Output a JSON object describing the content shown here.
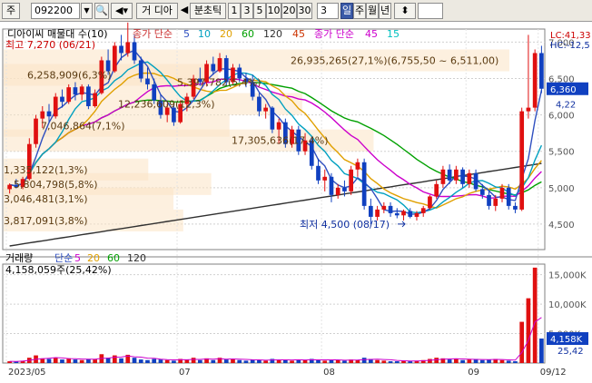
{
  "toolbar": {
    "market": "주",
    "code": "092200",
    "name_btn": "디아",
    "name_prefix": "거",
    "split_btn": "분초틱",
    "periods": [
      "1",
      "3",
      "5",
      "10",
      "20",
      "30"
    ],
    "count": "3",
    "day_btn": "일",
    "week_btn": "주",
    "month_btn": "월",
    "year_btn": "년"
  },
  "chart_data": [
    {
      "type": "candlestick",
      "title": "디아이씨 매물대 수(10)",
      "legend": [
        {
          "label": "종가 단순",
          "color": "#cc3333"
        },
        {
          "label": "5",
          "color": "#3050c0"
        },
        {
          "label": "10",
          "color": "#00a0c0"
        },
        {
          "label": "20",
          "color": "#e0a000"
        },
        {
          "label": "60",
          "color": "#00a000"
        },
        {
          "label": "120",
          "color": "#303030"
        },
        {
          "label": "45",
          "color": "#cc3300"
        },
        {
          "label": "종가 단순",
          "color": "#cc00cc"
        },
        {
          "label": "45",
          "color": "#cc00cc"
        },
        {
          "label": "15",
          "color": "#00c0c0"
        }
      ],
      "y_ticks": [
        4500,
        5000,
        5500,
        6000,
        6500,
        7000
      ],
      "ylim": [
        4150,
        7180
      ],
      "x_labels": [
        "2023/05",
        "07",
        "08",
        "09",
        "09/12"
      ],
      "x_label_index": [
        0,
        26,
        48,
        70,
        81
      ],
      "high_label": "최고 7,270 (06/21)",
      "low_label": "최저 4,500 (08/17)",
      "lc_label": "LC:41,33",
      "hc_label": "HC:-12,5",
      "pct_up_label": "4,22",
      "current_price": 6360,
      "current_price_label": "6,360",
      "volume_profile": [
        {
          "lo": 6400,
          "hi": 6700,
          "label": "6,258,909(6,3%)",
          "pct": 6.3
        },
        {
          "lo": 6600,
          "hi": 6900,
          "label": "26,935,265(27,1%)(6,755,50 ~ 6,511,00)",
          "pct": 27.1
        },
        {
          "lo": 6300,
          "hi": 6600,
          "label": "5,397,782(5,4%)",
          "pct": 5.4
        },
        {
          "lo": 6000,
          "hi": 6300,
          "label": "12,236,609(12,3%)",
          "pct": 12.3
        },
        {
          "lo": 5700,
          "hi": 6000,
          "label": "7,046,864(7,1%)",
          "pct": 7.1
        },
        {
          "lo": 5500,
          "hi": 5800,
          "label": "17,305,636(17,4%)",
          "pct": 17.4
        },
        {
          "lo": 5100,
          "hi": 5400,
          "label": "1,335,122(1,3%)",
          "pct": 1.3
        },
        {
          "lo": 4900,
          "hi": 5200,
          "label": "5,804,798(5,8%)",
          "pct": 5.8
        },
        {
          "lo": 4700,
          "hi": 5000,
          "label": "3,046,481(3,1%)",
          "pct": 3.1
        },
        {
          "lo": 4400,
          "hi": 4700,
          "label": "3,817,091(3,8%)",
          "pct": 3.8
        }
      ],
      "candles": [
        {
          "o": 4980,
          "h": 5060,
          "l": 4920,
          "c": 5040
        },
        {
          "o": 5040,
          "h": 5120,
          "l": 4990,
          "c": 5010
        },
        {
          "o": 5010,
          "h": 5150,
          "l": 4980,
          "c": 5120
        },
        {
          "o": 5120,
          "h": 5680,
          "l": 5100,
          "c": 5600
        },
        {
          "o": 5600,
          "h": 6000,
          "l": 5550,
          "c": 5950
        },
        {
          "o": 5950,
          "h": 6120,
          "l": 5820,
          "c": 6050
        },
        {
          "o": 6050,
          "h": 6150,
          "l": 5900,
          "c": 5980
        },
        {
          "o": 5980,
          "h": 6300,
          "l": 5950,
          "c": 6250
        },
        {
          "o": 6250,
          "h": 6350,
          "l": 6100,
          "c": 6180
        },
        {
          "o": 6180,
          "h": 6420,
          "l": 6150,
          "c": 6380
        },
        {
          "o": 6380,
          "h": 6450,
          "l": 6200,
          "c": 6280
        },
        {
          "o": 6280,
          "h": 6420,
          "l": 6200,
          "c": 6390
        },
        {
          "o": 6390,
          "h": 6420,
          "l": 6080,
          "c": 6120
        },
        {
          "o": 6120,
          "h": 6350,
          "l": 6100,
          "c": 6300
        },
        {
          "o": 6300,
          "h": 6800,
          "l": 6280,
          "c": 6750
        },
        {
          "o": 6750,
          "h": 6900,
          "l": 6550,
          "c": 6600
        },
        {
          "o": 6600,
          "h": 7000,
          "l": 6580,
          "c": 6950
        },
        {
          "o": 6950,
          "h": 7100,
          "l": 6750,
          "c": 6850
        },
        {
          "o": 6850,
          "h": 7270,
          "l": 6800,
          "c": 7000
        },
        {
          "o": 7000,
          "h": 7100,
          "l": 6700,
          "c": 6750
        },
        {
          "o": 6750,
          "h": 6800,
          "l": 6450,
          "c": 6500
        },
        {
          "o": 6500,
          "h": 6650,
          "l": 6350,
          "c": 6420
        },
        {
          "o": 6420,
          "h": 6500,
          "l": 6150,
          "c": 6200
        },
        {
          "o": 6200,
          "h": 6280,
          "l": 5950,
          "c": 6000
        },
        {
          "o": 6000,
          "h": 6150,
          "l": 5900,
          "c": 6100
        },
        {
          "o": 6100,
          "h": 6150,
          "l": 5850,
          "c": 5900
        },
        {
          "o": 5900,
          "h": 6200,
          "l": 5880,
          "c": 6150
        },
        {
          "o": 6150,
          "h": 6300,
          "l": 6050,
          "c": 6250
        },
        {
          "o": 6250,
          "h": 6550,
          "l": 6220,
          "c": 6500
        },
        {
          "o": 6500,
          "h": 6650,
          "l": 6400,
          "c": 6450
        },
        {
          "o": 6450,
          "h": 6750,
          "l": 6400,
          "c": 6700
        },
        {
          "o": 6700,
          "h": 6800,
          "l": 6550,
          "c": 6600
        },
        {
          "o": 6600,
          "h": 6850,
          "l": 6580,
          "c": 6780
        },
        {
          "o": 6780,
          "h": 6820,
          "l": 6400,
          "c": 6450
        },
        {
          "o": 6450,
          "h": 6700,
          "l": 6420,
          "c": 6650
        },
        {
          "o": 6650,
          "h": 6700,
          "l": 6450,
          "c": 6500
        },
        {
          "o": 6500,
          "h": 6580,
          "l": 6380,
          "c": 6450
        },
        {
          "o": 6450,
          "h": 6550,
          "l": 6200,
          "c": 6250
        },
        {
          "o": 6250,
          "h": 6300,
          "l": 5980,
          "c": 6050
        },
        {
          "o": 6050,
          "h": 6150,
          "l": 5950,
          "c": 6100
        },
        {
          "o": 6100,
          "h": 6120,
          "l": 5750,
          "c": 5800
        },
        {
          "o": 5800,
          "h": 5950,
          "l": 5600,
          "c": 5900
        },
        {
          "o": 5900,
          "h": 5950,
          "l": 5550,
          "c": 5600
        },
        {
          "o": 5600,
          "h": 5850,
          "l": 5550,
          "c": 5800
        },
        {
          "o": 5800,
          "h": 5850,
          "l": 5450,
          "c": 5500
        },
        {
          "o": 5500,
          "h": 5750,
          "l": 5450,
          "c": 5650
        },
        {
          "o": 5650,
          "h": 5700,
          "l": 5250,
          "c": 5300
        },
        {
          "o": 5300,
          "h": 5400,
          "l": 5050,
          "c": 5100
        },
        {
          "o": 5100,
          "h": 5250,
          "l": 4950,
          "c": 5150
        },
        {
          "o": 5150,
          "h": 5200,
          "l": 4800,
          "c": 4900
        },
        {
          "o": 4900,
          "h": 5050,
          "l": 4850,
          "c": 5000
        },
        {
          "o": 5000,
          "h": 5100,
          "l": 4880,
          "c": 4950
        },
        {
          "o": 4950,
          "h": 5300,
          "l": 4900,
          "c": 5250
        },
        {
          "o": 5250,
          "h": 5400,
          "l": 5150,
          "c": 5350
        },
        {
          "o": 5350,
          "h": 5400,
          "l": 4700,
          "c": 4750
        },
        {
          "o": 4750,
          "h": 4850,
          "l": 4500,
          "c": 4600
        },
        {
          "o": 4600,
          "h": 4750,
          "l": 4550,
          "c": 4700
        },
        {
          "o": 4700,
          "h": 4800,
          "l": 4650,
          "c": 4750
        },
        {
          "o": 4750,
          "h": 4800,
          "l": 4600,
          "c": 4650
        },
        {
          "o": 4650,
          "h": 4720,
          "l": 4580,
          "c": 4620
        },
        {
          "o": 4620,
          "h": 4700,
          "l": 4550,
          "c": 4680
        },
        {
          "o": 4680,
          "h": 4720,
          "l": 4580,
          "c": 4600
        },
        {
          "o": 4600,
          "h": 4680,
          "l": 4550,
          "c": 4650
        },
        {
          "o": 4650,
          "h": 4750,
          "l": 4600,
          "c": 4720
        },
        {
          "o": 4720,
          "h": 4900,
          "l": 4700,
          "c": 4880
        },
        {
          "o": 4880,
          "h": 5100,
          "l": 4850,
          "c": 5050
        },
        {
          "o": 5050,
          "h": 5300,
          "l": 5000,
          "c": 5250
        },
        {
          "o": 5250,
          "h": 5320,
          "l": 5050,
          "c": 5100
        },
        {
          "o": 5100,
          "h": 5300,
          "l": 5050,
          "c": 5250
        },
        {
          "o": 5250,
          "h": 5280,
          "l": 5000,
          "c": 5050
        },
        {
          "o": 5050,
          "h": 5250,
          "l": 5000,
          "c": 5200
        },
        {
          "o": 5200,
          "h": 5250,
          "l": 4950,
          "c": 4980
        },
        {
          "o": 4980,
          "h": 5050,
          "l": 4850,
          "c": 4900
        },
        {
          "o": 4900,
          "h": 4950,
          "l": 4700,
          "c": 4750
        },
        {
          "o": 4750,
          "h": 4900,
          "l": 4680,
          "c": 4850
        },
        {
          "o": 4850,
          "h": 5050,
          "l": 4800,
          "c": 5000
        },
        {
          "o": 5000,
          "h": 5050,
          "l": 4700,
          "c": 4750
        },
        {
          "o": 4750,
          "h": 4800,
          "l": 4650,
          "c": 4700
        },
        {
          "o": 4700,
          "h": 6100,
          "l": 4680,
          "c": 6050
        },
        {
          "o": 6050,
          "h": 7100,
          "l": 5950,
          "c": 6100
        },
        {
          "o": 6100,
          "h": 6900,
          "l": 6050,
          "c": 6850
        },
        {
          "o": 6850,
          "h": 6950,
          "l": 6300,
          "c": 6360
        }
      ],
      "ma5_color": "#3050c0",
      "ma10_color": "#00a0c0",
      "ma20_color": "#e0a000",
      "ma60_color": "#00a000",
      "ma120_color": "#303030",
      "ma45_color": "#cc00cc"
    },
    {
      "type": "bar",
      "title": "거래량",
      "legend": [
        {
          "label": "단순",
          "color": "#3050c0"
        },
        {
          "label": "5",
          "color": "#cc00cc"
        },
        {
          "label": "20",
          "color": "#e0a000"
        },
        {
          "label": "60",
          "color": "#00a000"
        },
        {
          "label": "120",
          "color": "#303030"
        }
      ],
      "last_label": "4,158,059주(25,42%)",
      "y_ticks": [
        5000,
        10000,
        15000
      ],
      "y_tick_labels": [
        "5,000K",
        "10,000K",
        "15,000K"
      ],
      "ylim": [
        0,
        16800
      ],
      "current_label": "4,158K",
      "pct_label": "25,42",
      "values": [
        300,
        250,
        400,
        900,
        1300,
        800,
        700,
        900,
        600,
        800,
        600,
        500,
        700,
        600,
        1500,
        900,
        1300,
        800,
        1400,
        900,
        600,
        500,
        700,
        600,
        500,
        400,
        700,
        600,
        900,
        500,
        800,
        500,
        900,
        600,
        700,
        500,
        400,
        600,
        500,
        400,
        700,
        500,
        600,
        400,
        600,
        500,
        700,
        500,
        400,
        600,
        500,
        400,
        600,
        500,
        900,
        700,
        500,
        400,
        300,
        300,
        400,
        300,
        400,
        500,
        700,
        900,
        800,
        600,
        700,
        500,
        600,
        700,
        500,
        600,
        700,
        500,
        400,
        300,
        7000,
        11000,
        16200,
        4158
      ]
    }
  ]
}
